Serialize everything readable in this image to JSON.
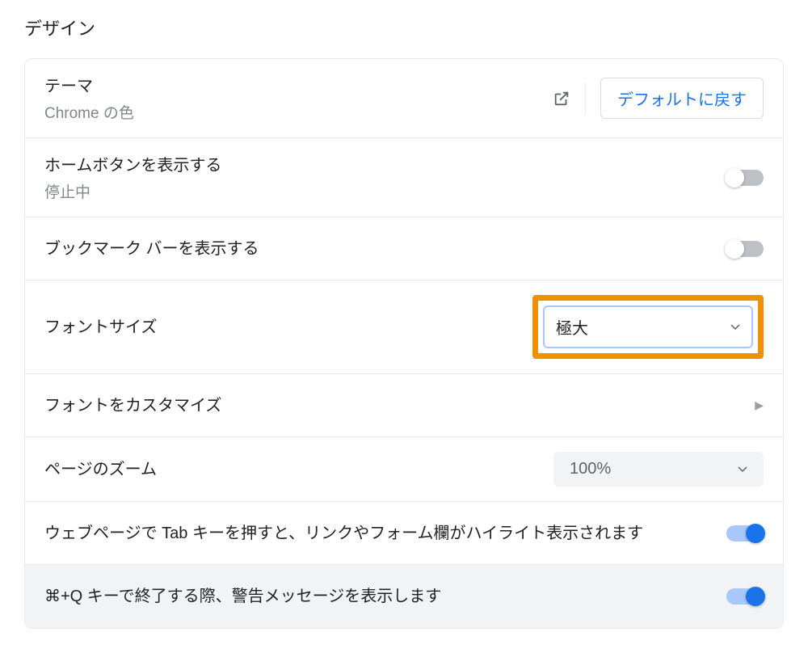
{
  "section_title": "デザイン",
  "theme": {
    "label": "テーマ",
    "sublabel": "Chrome の色",
    "reset_button": "デフォルトに戻す"
  },
  "home_button": {
    "label": "ホームボタンを表示する",
    "sublabel": "停止中",
    "enabled": false
  },
  "bookmark_bar": {
    "label": "ブックマーク バーを表示する",
    "enabled": false
  },
  "font_size": {
    "label": "フォントサイズ",
    "selected": "極大"
  },
  "font_customize": {
    "label": "フォントをカスタマイズ"
  },
  "page_zoom": {
    "label": "ページのズーム",
    "selected": "100%"
  },
  "tab_highlight": {
    "label": "ウェブページで Tab キーを押すと、リンクやフォーム欄がハイライト表示されます",
    "enabled": true
  },
  "quit_warning": {
    "label": "⌘+Q キーで終了する際、警告メッセージを表示します",
    "enabled": true
  }
}
